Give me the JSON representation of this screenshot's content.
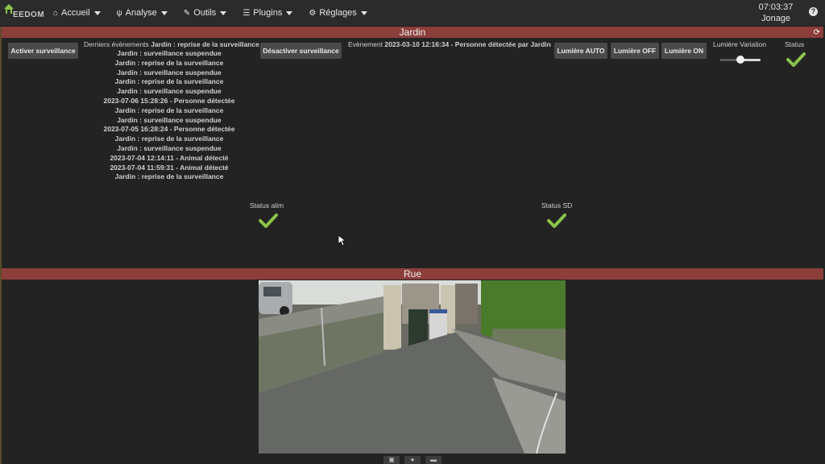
{
  "navbar": {
    "logo_text": "EEDOM",
    "menu": [
      {
        "label": "Accueil",
        "icon": "home-icon"
      },
      {
        "label": "Analyse",
        "icon": "stethoscope-icon"
      },
      {
        "label": "Outils",
        "icon": "wrench-icon"
      },
      {
        "label": "Plugins",
        "icon": "list-icon"
      },
      {
        "label": "Réglages",
        "icon": "gear-icon"
      }
    ],
    "time": "07:03:37",
    "user": "Jonage",
    "help_label": "?"
  },
  "jardin": {
    "title": "Jardin",
    "activate_button": "Activer surveillance",
    "events_label": "Derniers évènements",
    "events": [
      "Jardin : reprise de la surveillance",
      "Jardin : surveillance suspendue",
      "Jardin : reprise de la surveillance",
      "Jardin : surveillance suspendue",
      "Jardin : reprise de la surveillance",
      "Jardin : surveillance suspendue",
      "2023-07-06 15:28:26 - Personne détectée",
      "Jardin : reprise de la surveillance",
      "Jardin : surveillance suspendue",
      "2023-07-05 16:28:24 - Personne détectée",
      "Jardin : reprise de la surveillance",
      "Jardin : surveillance suspendue",
      "2023-07-04 12:14:11 - Animal détecté",
      "2023-07-04 11:59:31 - Animal détecté",
      "Jardin : reprise de la surveillance"
    ],
    "deactivate_button": "Désactiver surveillance",
    "event_label": "Evènement",
    "event_value": "2023-03-10 12:16:34 - Personne détectée par Jardin",
    "light_auto": "Lumière AUTO",
    "light_off": "Lumière OFF",
    "light_on": "Lumière ON",
    "light_variation_label": "Lumière Variation",
    "light_variation_level": 0.5,
    "status_label": "Status",
    "status_alim_label": "Status alim",
    "status_sd_label": "Status SD",
    "check_color": "#8bc34a"
  },
  "rue": {
    "title": "Rue"
  },
  "theme": {
    "panel_header": "#8c3e3a",
    "background": "#232323"
  }
}
